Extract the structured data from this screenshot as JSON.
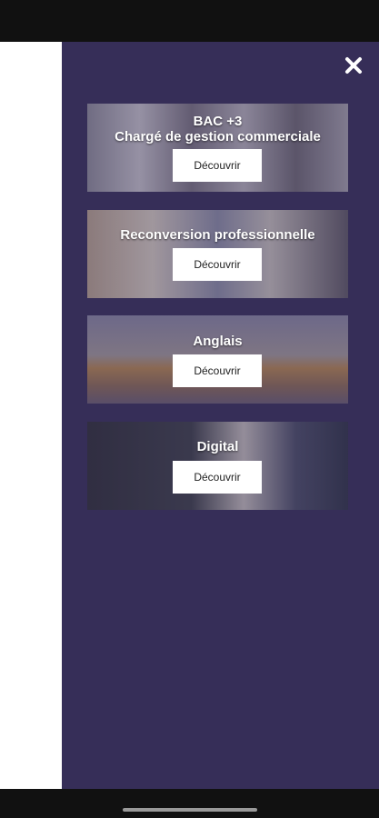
{
  "drawer": {
    "close_icon": "close-icon",
    "cards": [
      {
        "title_line1": "BAC +3",
        "title_line2": "Chargé de gestion commerciale",
        "button": "Découvrir"
      },
      {
        "title_line1": "Reconversion professionnelle",
        "title_line2": "",
        "button": "Découvrir"
      },
      {
        "title_line1": "Anglais",
        "title_line2": "",
        "button": "Découvrir"
      },
      {
        "title_line1": "Digital",
        "title_line2": "",
        "button": "Découvrir"
      }
    ]
  },
  "colors": {
    "drawer_bg": "#362e58",
    "card_button_bg": "#ffffff",
    "backdrop_page": "#ffffff",
    "status_bar": "#111111"
  }
}
